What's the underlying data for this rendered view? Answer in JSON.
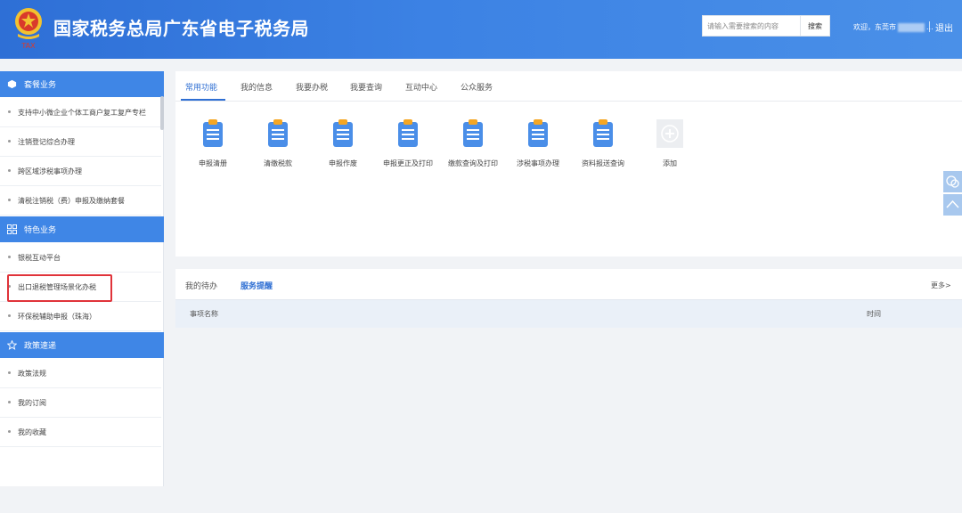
{
  "header": {
    "site_title": "国家税务总局广东省电子税务局",
    "emblem_text": "TAX",
    "search_placeholder": "请输入需要搜索的内容",
    "search_button": "搜索",
    "welcome_prefix": "欢迎，东莞市",
    "welcome_suffix": "...",
    "logout": "退出"
  },
  "sidebar": {
    "groups": [
      {
        "label": "套餐业务",
        "icon": "cube-icon",
        "items": [
          "支持中小微企业个体工商户复工复产专栏",
          "注销登记综合办理",
          "跨区域涉税事项办理",
          "清税注销税（费）申报及缴纳套餐"
        ]
      },
      {
        "label": "特色业务",
        "icon": "grid-icon",
        "items": [
          "银税互动平台",
          "出口退税管理场景化办税",
          "环保税辅助申报（珠海）"
        ]
      },
      {
        "label": "政策速递",
        "icon": "star-icon",
        "items": [
          "政策法规",
          "我的订阅",
          "我的收藏"
        ]
      }
    ]
  },
  "main": {
    "tabs": [
      "常用功能",
      "我的信息",
      "我要办税",
      "我要查询",
      "互动中心",
      "公众服务"
    ],
    "active_tab": 0,
    "functions": [
      "申报清册",
      "清缴税款",
      "申报作废",
      "申报更正及打印",
      "缴款查询及打印",
      "涉税事项办理",
      "资料报送查询"
    ],
    "add_label": "添加"
  },
  "reminders": {
    "tabs": [
      "我的待办",
      "服务提醒"
    ],
    "active_tab": 1,
    "more": "更多>",
    "columns": [
      "事项名称",
      "时间"
    ]
  },
  "colors": {
    "header_blue": "#3c82e4",
    "accent_blue": "#2f6fd3",
    "highlight_red": "#e0333a",
    "icon_blue": "#4a8ee8",
    "icon_orange": "#f5a623"
  }
}
